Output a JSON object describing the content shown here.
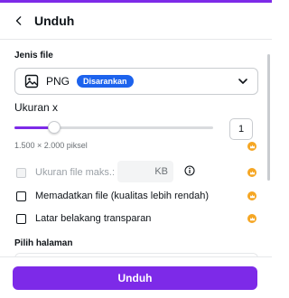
{
  "header": {
    "title": "Unduh"
  },
  "file_type": {
    "label": "Jenis file",
    "value": "PNG",
    "badge": "Disarankan"
  },
  "size": {
    "label": "Ukuran x",
    "scale_value": "1",
    "slider_fraction": 0.2,
    "dimensions": "1.500 × 2.000 piksel"
  },
  "options": {
    "max_file_size_label": "Ukuran file maks.:",
    "max_file_size_unit": "KB",
    "compress_label": "Memadatkan file (kualitas lebih rendah)",
    "transparent_label": "Latar belakang transparan"
  },
  "pages": {
    "label": "Pilih halaman"
  },
  "footer": {
    "download_label": "Unduh"
  },
  "colors": {
    "accent": "#7d2ae8",
    "badge": "#1d63ed",
    "premium": "#f5a623"
  }
}
